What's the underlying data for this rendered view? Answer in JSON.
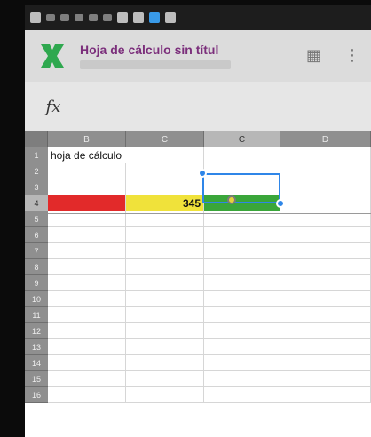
{
  "app": {
    "title": "Hoja de cálculo sin títul",
    "logo_icon": "calc-x-logo",
    "actions": [
      "grid-view-icon",
      "overflow-menu-icon"
    ]
  },
  "formula_bar": {
    "fx_label": "fx",
    "value": ""
  },
  "sheet": {
    "columns": [
      "B",
      "C",
      "C",
      "D"
    ],
    "active_column": "C",
    "rows": [
      "1",
      "2",
      "3",
      "4",
      "5",
      "6",
      "7",
      "8",
      "9",
      "10",
      "11",
      "12",
      "13",
      "14",
      "15",
      "16"
    ],
    "active_row": "4",
    "cells": {
      "A1": "hoja de cálculo",
      "C4": "345"
    },
    "fill_colors": {
      "row4_red": "#e22a2a",
      "row4_yellow": "#f0e23a",
      "row4_green": "#3aa63a"
    },
    "selection_color": "#2f86e8"
  }
}
